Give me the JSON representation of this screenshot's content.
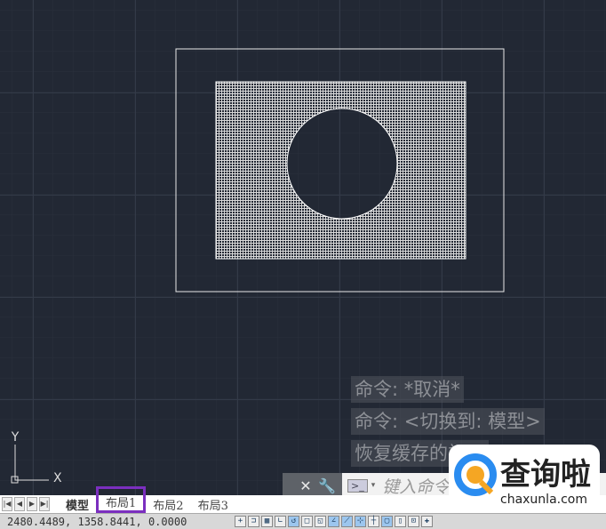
{
  "history": [
    "命令: *取消*",
    "命令:   <切换到: 模型>",
    "恢复缓存的视口"
  ],
  "command": {
    "placeholder": "键入命令",
    "close_icon": "x-icon",
    "settings_icon": "wrench-icon",
    "prompt_icon": "terminal-icon"
  },
  "ucs": {
    "x": "X",
    "y": "Y"
  },
  "tabs": [
    "模型",
    "布局1",
    "布局2",
    "布局3"
  ],
  "active_tab": "模型",
  "highlighted_tab": "布局1",
  "highlight_color": "#7b2fbf",
  "coordinates": "2480.4489, 1358.8441, 0.0000",
  "watermark": {
    "brand": "查询啦",
    "url": "chaxunla.com"
  }
}
